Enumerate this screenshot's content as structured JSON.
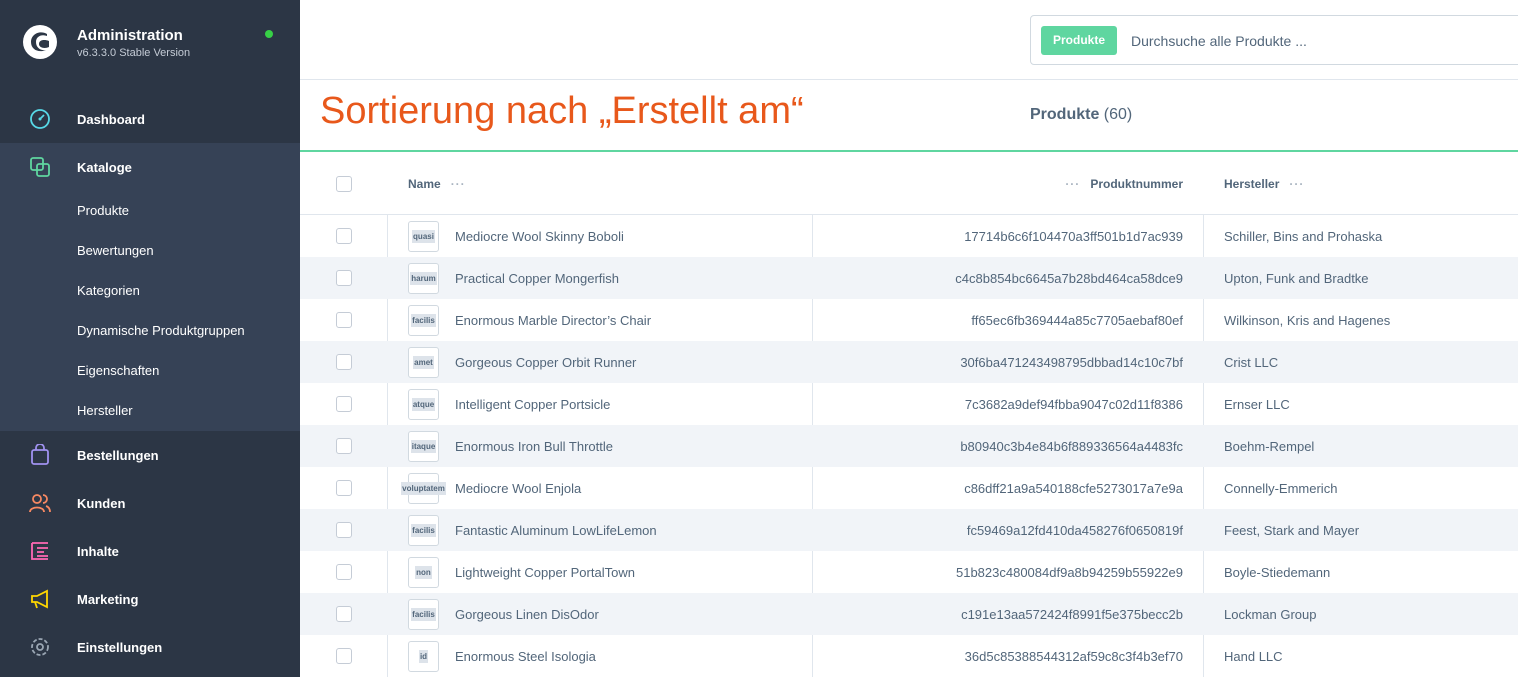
{
  "brand": {
    "title": "Administration",
    "version": "v6.3.3.0 Stable Version"
  },
  "nav": {
    "dashboard": "Dashboard",
    "kataloge": "Kataloge",
    "sub": [
      "Produkte",
      "Bewertungen",
      "Kategorien",
      "Dynamische Produktgruppen",
      "Eigenschaften",
      "Hersteller"
    ],
    "bestellungen": "Bestellungen",
    "kunden": "Kunden",
    "inhalte": "Inhalte",
    "marketing": "Marketing",
    "einstellungen": "Einstellungen"
  },
  "search": {
    "pill": "Produkte",
    "placeholder": "Durchsuche alle Produkte ..."
  },
  "annotation": "Sortierung nach „Erstellt am“",
  "heading": {
    "label": "Produkte",
    "count": "(60)"
  },
  "table": {
    "columns": {
      "name": "Name",
      "number": "Produktnummer",
      "manufacturer": "Hersteller"
    },
    "rows": [
      {
        "thumb": "quasi",
        "name": "Mediocre Wool Skinny Boboli",
        "number": "17714b6c6f104470a3ff501b1d7ac939",
        "manufacturer": "Schiller, Bins and Prohaska"
      },
      {
        "thumb": "harum",
        "name": "Practical Copper Mongerfish",
        "number": "c4c8b854bc6645a7b28bd464ca58dce9",
        "manufacturer": "Upton, Funk and Bradtke"
      },
      {
        "thumb": "facilis",
        "name": "Enormous Marble Director’s Chair",
        "number": "ff65ec6fb369444a85c7705aebaf80ef",
        "manufacturer": "Wilkinson, Kris and Hagenes"
      },
      {
        "thumb": "amet",
        "name": "Gorgeous Copper Orbit Runner",
        "number": "30f6ba471243498795dbbad14c10c7bf",
        "manufacturer": "Crist LLC"
      },
      {
        "thumb": "atque",
        "name": "Intelligent Copper Portsicle",
        "number": "7c3682a9def94fbba9047c02d11f8386",
        "manufacturer": "Ernser LLC"
      },
      {
        "thumb": "itaque",
        "name": "Enormous Iron Bull Throttle",
        "number": "b80940c3b4e84b6f889336564a4483fc",
        "manufacturer": "Boehm-Rempel"
      },
      {
        "thumb": "voluptatem",
        "name": "Mediocre Wool Enjola",
        "number": "c86dff21a9a540188cfe5273017a7e9a",
        "manufacturer": "Connelly-Emmerich"
      },
      {
        "thumb": "facilis",
        "name": "Fantastic Aluminum LowLifeLemon",
        "number": "fc59469a12fd410da458276f0650819f",
        "manufacturer": "Feest, Stark and Mayer"
      },
      {
        "thumb": "non",
        "name": "Lightweight Copper PortalTown",
        "number": "51b823c480084df9a8b94259b55922e9",
        "manufacturer": "Boyle-Stiedemann"
      },
      {
        "thumb": "facilis",
        "name": "Gorgeous Linen DisOdor",
        "number": "c191e13aa572424f8991f5e375becc2b",
        "manufacturer": "Lockman Group"
      },
      {
        "thumb": "id",
        "name": "Enormous Steel Isologia",
        "number": "36d5c85388544312af59c8c3f4b3ef70",
        "manufacturer": "Hand LLC"
      }
    ]
  },
  "colors": {
    "sidebar": "#2c3645",
    "accent": "#5fd6a0",
    "annotation": "#e8581b"
  }
}
